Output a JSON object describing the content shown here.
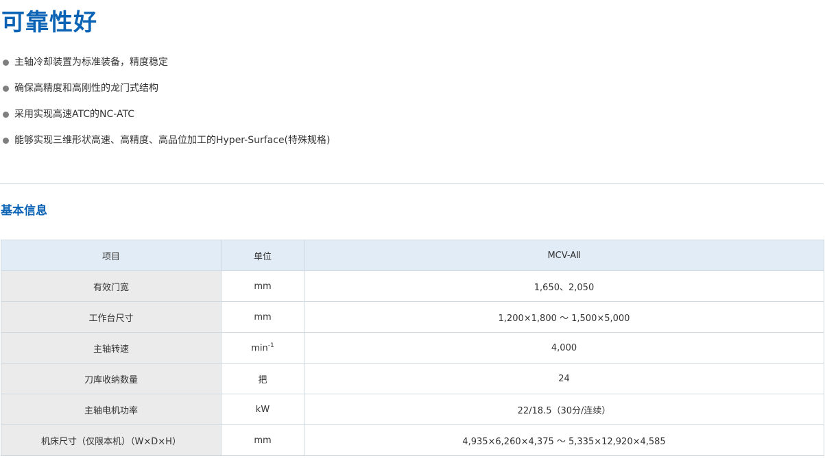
{
  "title": "可靠性好",
  "features": [
    "主轴冷却装置为标准装备，精度稳定",
    "确保高精度和高刚性的龙门式结构",
    "采用实现高速ATC的NC-ATC",
    "能够实现三维形状高速、高精度、高品位加工的Hyper-Surface(特殊规格)"
  ],
  "section_title": "基本信息",
  "table": {
    "headers": [
      "项目",
      "单位",
      "MCV-AⅡ"
    ],
    "rows": [
      {
        "item": "有效门宽",
        "unit": "mm",
        "value": "1,650、2,050"
      },
      {
        "item": "工作台尺寸",
        "unit": "mm",
        "value": "1,200×1,800 ～ 1,500×5,000"
      },
      {
        "item": "主轴转速",
        "unit": "min",
        "unit_sup": "-1",
        "value": "4,000"
      },
      {
        "item": "刀库收纳数量",
        "unit": "把",
        "value": "24"
      },
      {
        "item": "主轴电机功率",
        "unit": "kW",
        "value": "22/18.5（30分/连续）"
      },
      {
        "item": "机床尺寸（仅限本机）（W×D×H）",
        "unit": "mm",
        "value": "4,935×6,260×4,375 ～ 5,335×12,920×4,585"
      }
    ]
  },
  "colors": {
    "accent": "#0b63b5",
    "header_bg": "#e2ecf6",
    "label_bg": "#ebebeb",
    "bullet": "#7f7f7f"
  }
}
